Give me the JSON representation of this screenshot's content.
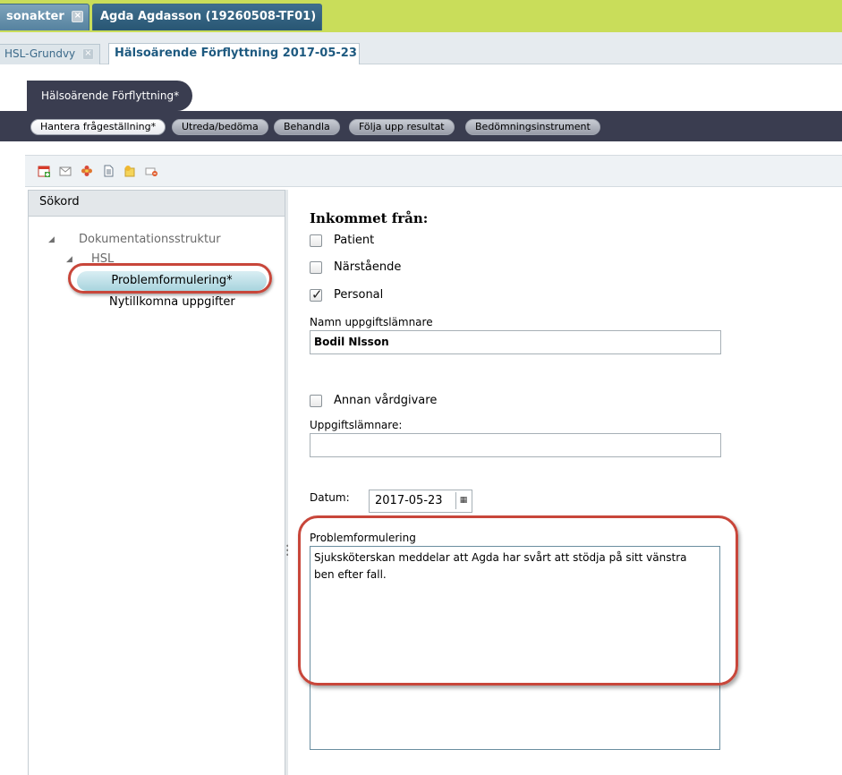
{
  "top_tabs": [
    {
      "label": "sonakter"
    },
    {
      "label": "Agda Agdasson (19260508-TF01)"
    }
  ],
  "sub_tabs": [
    {
      "label": "HSL-Grundvy"
    },
    {
      "label": "Hälsoärende Förflyttning 2017-05-23"
    }
  ],
  "stage": {
    "title": "Hälsoärende Förflyttning*"
  },
  "steps": [
    {
      "label": "Hantera frågeställning*"
    },
    {
      "label": "Utreda/bedöma"
    },
    {
      "label": "Behandla"
    },
    {
      "label": "Följa upp resultat"
    },
    {
      "label": "Bedömningsinstrument"
    }
  ],
  "toolbar": {
    "icons": [
      "calendar-add-icon",
      "envelope-icon",
      "flower-icon",
      "document-icon",
      "star-note-icon",
      "remove-icon"
    ]
  },
  "left_panel": {
    "header": "Sökord",
    "tree": {
      "root": "Dokumentationsstruktur",
      "group": "HSL",
      "items": [
        "Problemformulering*",
        "Nytillkomna uppgifter"
      ]
    }
  },
  "form": {
    "heading": "Inkommet från:",
    "checkboxes": [
      {
        "label": "Patient",
        "checked": false
      },
      {
        "label": "Närstående",
        "checked": false
      },
      {
        "label": "Personal",
        "checked": true
      }
    ],
    "informant_name_label": "Namn uppgiftslämnare",
    "informant_name_value": "Bodil Nlsson",
    "other_provider_label": "Annan vårdgivare",
    "informant_label": "Uppgiftslämnare:",
    "informant_value": "",
    "date_label": "Datum:",
    "date_value": "2017-05-23",
    "problem_label": "Problemformulering",
    "problem_text": "Sjuksköterskan meddelar att Agda har svårt att stödja på sitt vänstra\nben efter fall."
  },
  "colors": {
    "highlight_oval": "#c8463a",
    "stage_bar": "#3a3d50",
    "top_strip": "#c9dd5a"
  }
}
